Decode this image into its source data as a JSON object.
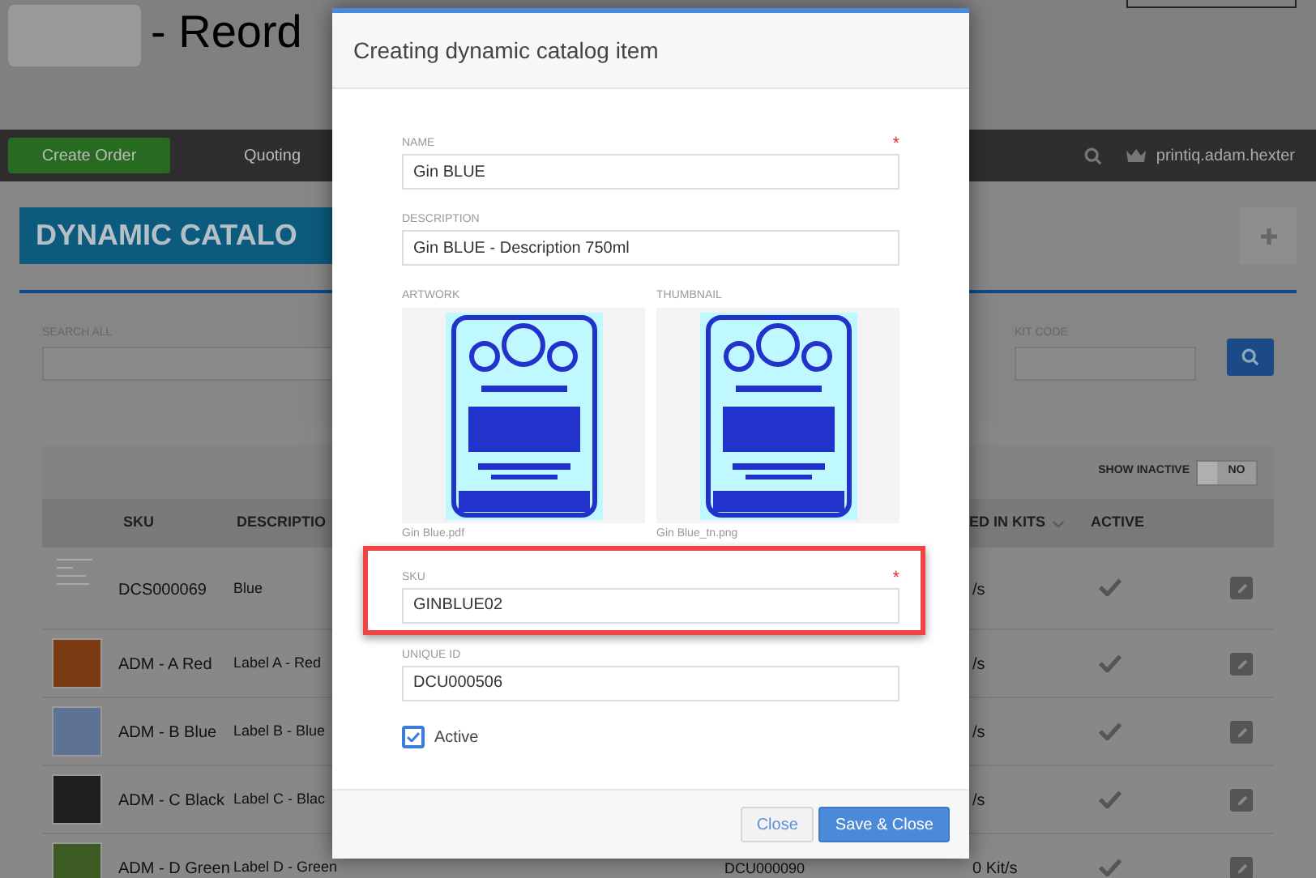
{
  "header": {
    "title": "- Reord"
  },
  "nav": {
    "items": [
      {
        "label": "Create Order",
        "selected": true
      },
      {
        "label": "Quoting",
        "selected": false
      }
    ],
    "user": "printiq.adam.hexter"
  },
  "page": {
    "title": "DYNAMIC CATALO"
  },
  "filters": [
    {
      "label": "SEARCH ALL"
    },
    {
      "label": "KIT CODE"
    }
  ],
  "toolbar": {
    "show_inactive_label": "SHOW INACTIVE",
    "toggle": {
      "label": "NO",
      "on": false
    }
  },
  "table": {
    "columns": [
      "SKU",
      "DESCRIPTIO",
      "ED IN KITS",
      "ACTIVE"
    ],
    "rows": [
      {
        "kind": "document",
        "sku": "DCS000069",
        "description": "Blue",
        "column_4": "/s",
        "active": true
      },
      {
        "kind": "label",
        "color": "#7a3a12",
        "sku": "ADM - A Red",
        "description": "Label A - Red",
        "column_4": "/s",
        "active": true
      },
      {
        "kind": "label",
        "color": "#5e7296",
        "sku": "ADM - B Blue",
        "description": "Label B - Blue",
        "column_4": "/s",
        "active": true
      },
      {
        "kind": "label",
        "color": "#1e1e1e",
        "sku": "ADM - C Black",
        "description": "Label C - Blac",
        "column_4": "/s",
        "active": true
      },
      {
        "kind": "label",
        "color": "#3c5a22",
        "sku": "ADM - D Green",
        "description": "Label D - Green",
        "column_3": "DCU000090",
        "column_4": "0 Kit/s",
        "active": true
      }
    ]
  },
  "modal": {
    "title": "Creating dynamic catalog item",
    "name": {
      "label": "NAME",
      "value": "Gin BLUE",
      "required_mark": "*"
    },
    "description": {
      "label": "DESCRIPTION",
      "value": "Gin BLUE - Description 750ml"
    },
    "artwork": {
      "label": "ARTWORK",
      "filename": "Gin Blue.pdf"
    },
    "thumbnail": {
      "label": "THUMBNAIL",
      "filename": "Gin Blue_tn.png"
    },
    "sku": {
      "label": "SKU",
      "value": "GINBLUE02",
      "required_mark": "*",
      "highlighted": true
    },
    "unique_id": {
      "label": "UNIQUE ID",
      "value": "DCU000506"
    },
    "active": {
      "label": "Active",
      "checked": true
    },
    "buttons": [
      {
        "label": "Close",
        "kind": "secondary"
      },
      {
        "label": "Save & Close",
        "kind": "primary"
      }
    ]
  }
}
